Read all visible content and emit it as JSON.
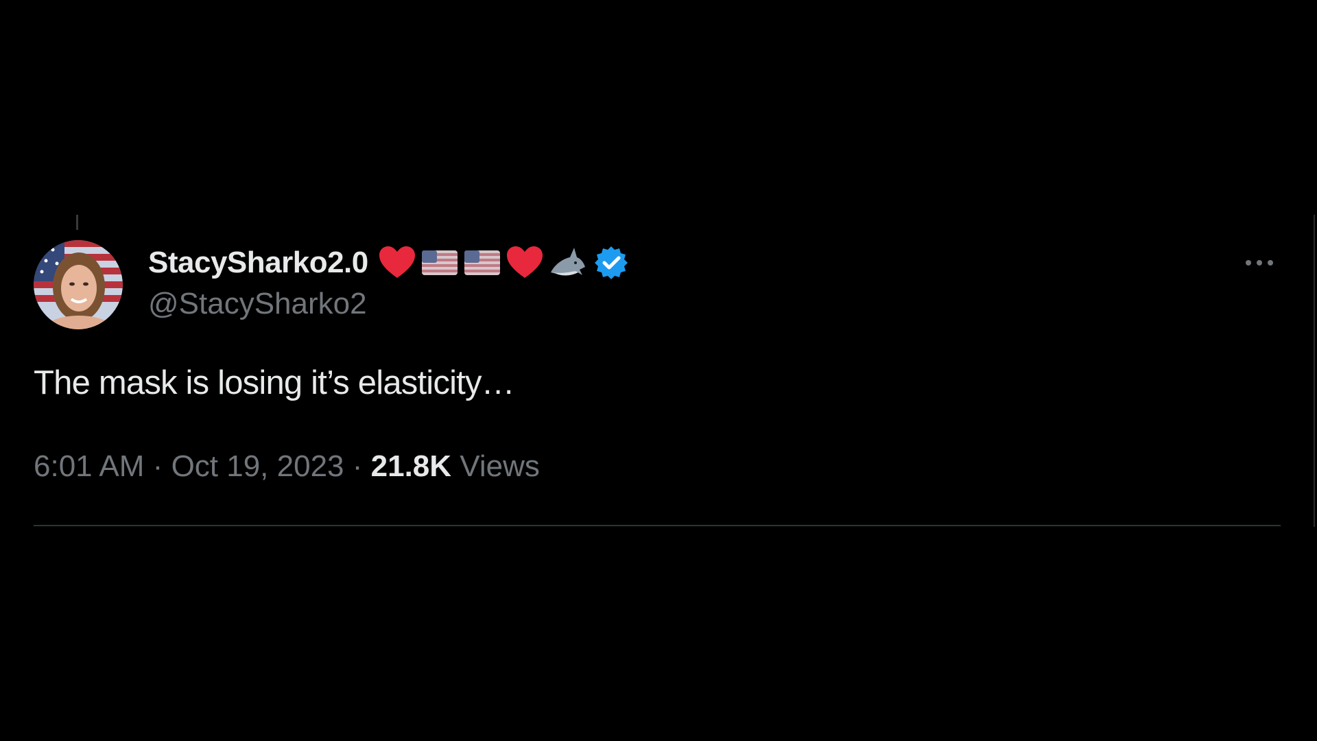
{
  "tweet": {
    "author": {
      "display_name": "StacySharko2.0",
      "emojis": [
        "red-heart",
        "us-flag",
        "us-flag",
        "red-heart",
        "shark"
      ],
      "verified": true,
      "verified_color": "#1d9bf0",
      "handle": "@StacySharko2"
    },
    "text": "The mask is losing it’s elasticity…",
    "time": "6:01 AM",
    "separator": "·",
    "date": "Oct 19, 2023",
    "views_count": "21.8K",
    "views_label": "Views"
  },
  "colors": {
    "background": "#000000",
    "primary_text": "#e7e9ea",
    "secondary_text": "#71767b",
    "divider": "#2f3336",
    "heart": "#e8283c"
  }
}
